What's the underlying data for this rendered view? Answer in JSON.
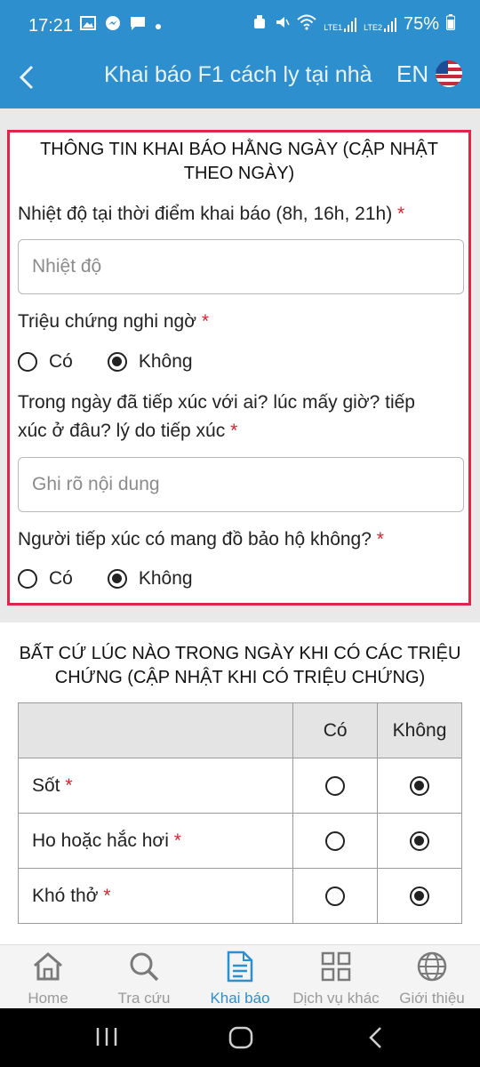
{
  "status_bar": {
    "time": "17:21",
    "battery": "75%",
    "sim1": "LTE1",
    "sim2": "LTE2",
    "icons": [
      "gallery-icon",
      "messenger-icon",
      "chat-icon",
      "dot-icon",
      "alarm-icon",
      "mute-icon",
      "wifi-icon",
      "signal-icon",
      "battery-icon"
    ]
  },
  "header": {
    "title": "Khai báo F1 cách ly tại nhà",
    "lang_label": "EN"
  },
  "daily_form": {
    "section_title": "THÔNG TIN KHAI BÁO HẰNG NGÀY (CẬP NHẬT THEO NGÀY)",
    "required_mark": "*",
    "temperature": {
      "label": "Nhiệt độ tại thời điểm khai báo (8h, 16h, 21h)",
      "placeholder": "Nhiệt độ",
      "value": ""
    },
    "symptoms": {
      "label": "Triệu chứng nghi ngờ",
      "option_yes": "Có",
      "option_no": "Không",
      "selected": "Không"
    },
    "contact": {
      "label": "Trong ngày đã tiếp xúc với ai? lúc mấy giờ? tiếp xúc ở đâu? lý do tiếp xúc",
      "placeholder": "Ghi rõ nội dung",
      "value": ""
    },
    "protection": {
      "label": "Người tiếp xúc có mang đồ bảo hộ không?",
      "option_yes": "Có",
      "option_no": "Không",
      "selected": "Không"
    }
  },
  "symptom_section": {
    "title": "BẤT CỨ LÚC NÀO TRONG NGÀY KHI CÓ CÁC TRIỆU CHỨNG (CẬP  NHẬT KHI CÓ TRIỆU CHỨNG)",
    "col_yes": "Có",
    "col_no": "Không",
    "rows": [
      {
        "name": "Sốt",
        "selected": "Không"
      },
      {
        "name": "Ho hoặc hắc hơi",
        "selected": "Không"
      },
      {
        "name": "Khó thở",
        "selected": "Không"
      }
    ]
  },
  "bottom_nav": {
    "items": [
      {
        "label": "Home",
        "icon": "home-icon",
        "active": false
      },
      {
        "label": "Tra cứu",
        "icon": "search-icon",
        "active": false
      },
      {
        "label": "Khai báo",
        "icon": "document-icon",
        "active": true
      },
      {
        "label": "Dịch vụ khác",
        "icon": "grid-icon",
        "active": false
      },
      {
        "label": "Giới thiệu",
        "icon": "globe-icon",
        "active": false
      }
    ]
  },
  "colors": {
    "primary": "#2d8fce",
    "highlight_border": "#e0254a",
    "required": "#d3232e"
  }
}
